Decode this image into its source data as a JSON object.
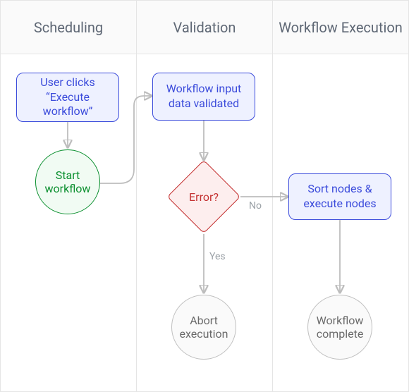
{
  "lanes": {
    "scheduling": "Scheduling",
    "validation": "Validation",
    "execution": "Workflow Execution"
  },
  "nodes": {
    "user_clicks": "User clicks “Execute workflow”",
    "start_workflow": "Start workflow",
    "input_validated": "Workflow input data validated",
    "error": "Error?",
    "abort": "Abort execution",
    "sort_execute": "Sort nodes & execute nodes",
    "complete": "Workflow complete"
  },
  "edges": {
    "no": "No",
    "yes": "Yes"
  },
  "colors": {
    "lane_border": "#e5e5e5",
    "rect_fill": "#eef1ff",
    "rect_border": "#3b4bdb",
    "green_fill": "#f1fbf3",
    "green_border": "#0a8f2e",
    "gray_fill": "#fafafa",
    "gray_border": "#bfbfbf",
    "red_fill": "#fdeeee",
    "red_border": "#c43131",
    "connector": "#bdbdbd"
  },
  "chart_data": {
    "type": "diagram",
    "title": "",
    "lanes": [
      "Scheduling",
      "Validation",
      "Workflow Execution"
    ],
    "nodes": [
      {
        "id": "user_clicks",
        "lane": "Scheduling",
        "shape": "rect",
        "label": "User clicks “Execute workflow”"
      },
      {
        "id": "start_workflow",
        "lane": "Scheduling",
        "shape": "circle",
        "label": "Start workflow",
        "style": "green"
      },
      {
        "id": "input_validated",
        "lane": "Validation",
        "shape": "rect",
        "label": "Workflow input data validated"
      },
      {
        "id": "error",
        "lane": "Validation",
        "shape": "diamond",
        "label": "Error?",
        "style": "red"
      },
      {
        "id": "abort",
        "lane": "Validation",
        "shape": "circle",
        "label": "Abort execution",
        "style": "gray"
      },
      {
        "id": "sort_execute",
        "lane": "Workflow Execution",
        "shape": "rect",
        "label": "Sort nodes & execute nodes"
      },
      {
        "id": "complete",
        "lane": "Workflow Execution",
        "shape": "circle",
        "label": "Workflow complete",
        "style": "gray"
      }
    ],
    "edges": [
      {
        "from": "user_clicks",
        "to": "start_workflow"
      },
      {
        "from": "start_workflow",
        "to": "input_validated"
      },
      {
        "from": "input_validated",
        "to": "error"
      },
      {
        "from": "error",
        "to": "sort_execute",
        "label": "No"
      },
      {
        "from": "error",
        "to": "abort",
        "label": "Yes"
      },
      {
        "from": "sort_execute",
        "to": "complete"
      }
    ]
  }
}
